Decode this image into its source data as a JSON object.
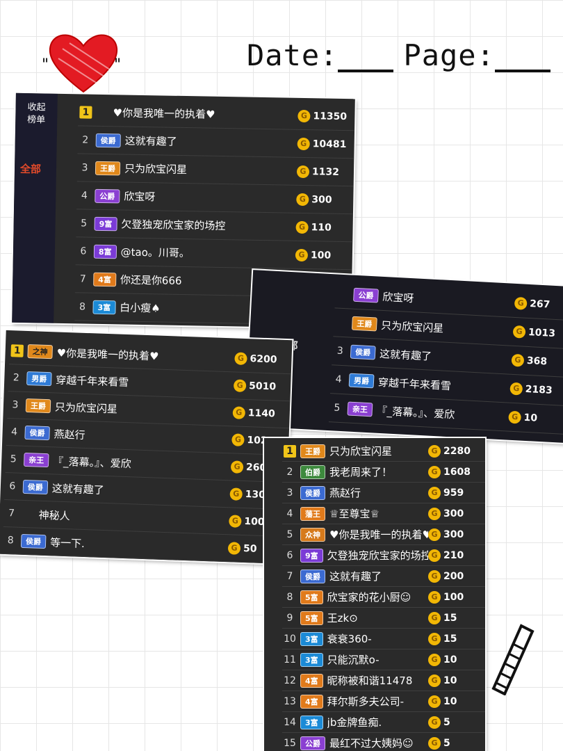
{
  "header": {
    "date_label": "Date:",
    "page_label": "Page:"
  },
  "panel1": {
    "collapse_label": "收起\n榜单",
    "tab_all": "全部",
    "rows": [
      {
        "rank": "1",
        "badge": "",
        "name": "♥你是我唯一的执着♥",
        "score": "11350"
      },
      {
        "rank": "2",
        "badge": "侯爵",
        "name": "这就有趣了",
        "score": "10481"
      },
      {
        "rank": "3",
        "badge": "王爵",
        "name": "只为欣宝闪星",
        "score": "1132"
      },
      {
        "rank": "4",
        "badge": "公爵",
        "name": "欣宝呀",
        "score": "300"
      },
      {
        "rank": "5",
        "badge": "9富",
        "name": "欠登独宠欣宝家的场控",
        "score": "110"
      },
      {
        "rank": "6",
        "badge": "8富",
        "name": "@tao。川哥。",
        "score": "100"
      },
      {
        "rank": "7",
        "badge": "4富",
        "name": "你还是你666",
        "score": "30"
      },
      {
        "rank": "8",
        "badge": "3富",
        "name": "白小瘦♠",
        "score": "20"
      }
    ]
  },
  "panel2": {
    "rows": [
      {
        "rank": "1",
        "badge": "之神",
        "name": "♥你是我唯一的执着♥",
        "score": "6200"
      },
      {
        "rank": "2",
        "badge": "男爵",
        "name": "穿越千年来看雪",
        "score": "5010"
      },
      {
        "rank": "3",
        "badge": "王爵",
        "name": "只为欣宝闪星",
        "score": "1140"
      },
      {
        "rank": "4",
        "badge": "侯爵",
        "name": "燕赵行",
        "score": "1025"
      },
      {
        "rank": "5",
        "badge": "亲王",
        "name": "『_落幕。』、爱欣",
        "score": "260"
      },
      {
        "rank": "6",
        "badge": "侯爵",
        "name": "这就有趣了",
        "score": "130"
      },
      {
        "rank": "7",
        "badge": "",
        "name": "神秘人",
        "score": "100"
      },
      {
        "rank": "8",
        "badge": "侯爵",
        "name": "等一下.",
        "score": "50"
      }
    ]
  },
  "panel3": {
    "tab_all": "全部",
    "rows": [
      {
        "rank": "",
        "badge": "公爵",
        "name": "欣宝呀",
        "score": "267"
      },
      {
        "rank": "",
        "badge": "王爵",
        "name": "只为欣宝闪星",
        "score": "1013"
      },
      {
        "rank": "3",
        "badge": "侯爵",
        "name": "这就有趣了",
        "score": "368"
      },
      {
        "rank": "4",
        "badge": "男爵",
        "name": "穿越千年来看雪",
        "score": "2183"
      },
      {
        "rank": "5",
        "badge": "亲王",
        "name": "『_落幕。』、爱欣",
        "score": "10"
      }
    ]
  },
  "panel4": {
    "rows": [
      {
        "rank": "1",
        "badge": "王爵",
        "name": "只为欣宝闪星",
        "score": "2280"
      },
      {
        "rank": "2",
        "badge": "伯爵",
        "name": "我老周来了！",
        "score": "1608"
      },
      {
        "rank": "3",
        "badge": "侯爵",
        "name": "燕赵行",
        "score": "959"
      },
      {
        "rank": "4",
        "badge": "藩王",
        "name": "♕至尊宝♕",
        "score": "300"
      },
      {
        "rank": "5",
        "badge": "众神",
        "name": "♥你是我唯一的执着♥",
        "score": "300"
      },
      {
        "rank": "6",
        "badge": "9富",
        "name": "欠登独宠欣宝家的场控",
        "score": "210"
      },
      {
        "rank": "7",
        "badge": "侯爵",
        "name": "这就有趣了",
        "score": "200"
      },
      {
        "rank": "8",
        "badge": "5富",
        "name": "欣宝家的花小厨☺",
        "score": "100"
      },
      {
        "rank": "9",
        "badge": "5富",
        "name": "王zk⊙",
        "score": "15"
      },
      {
        "rank": "10",
        "badge": "3富",
        "name": "衰衰360-",
        "score": "15"
      },
      {
        "rank": "11",
        "badge": "3富",
        "name": "只能沉默o-",
        "score": "10"
      },
      {
        "rank": "12",
        "badge": "4富",
        "name": "昵称被和谐11478",
        "score": "10"
      },
      {
        "rank": "13",
        "badge": "4富",
        "name": "拜尔斯多夫公司-",
        "score": "10"
      },
      {
        "rank": "14",
        "badge": "3富",
        "name": "jb金牌鱼痴.",
        "score": "5"
      },
      {
        "rank": "15",
        "badge": "公爵",
        "name": "最红不过大姨妈☺",
        "score": "5"
      }
    ]
  }
}
